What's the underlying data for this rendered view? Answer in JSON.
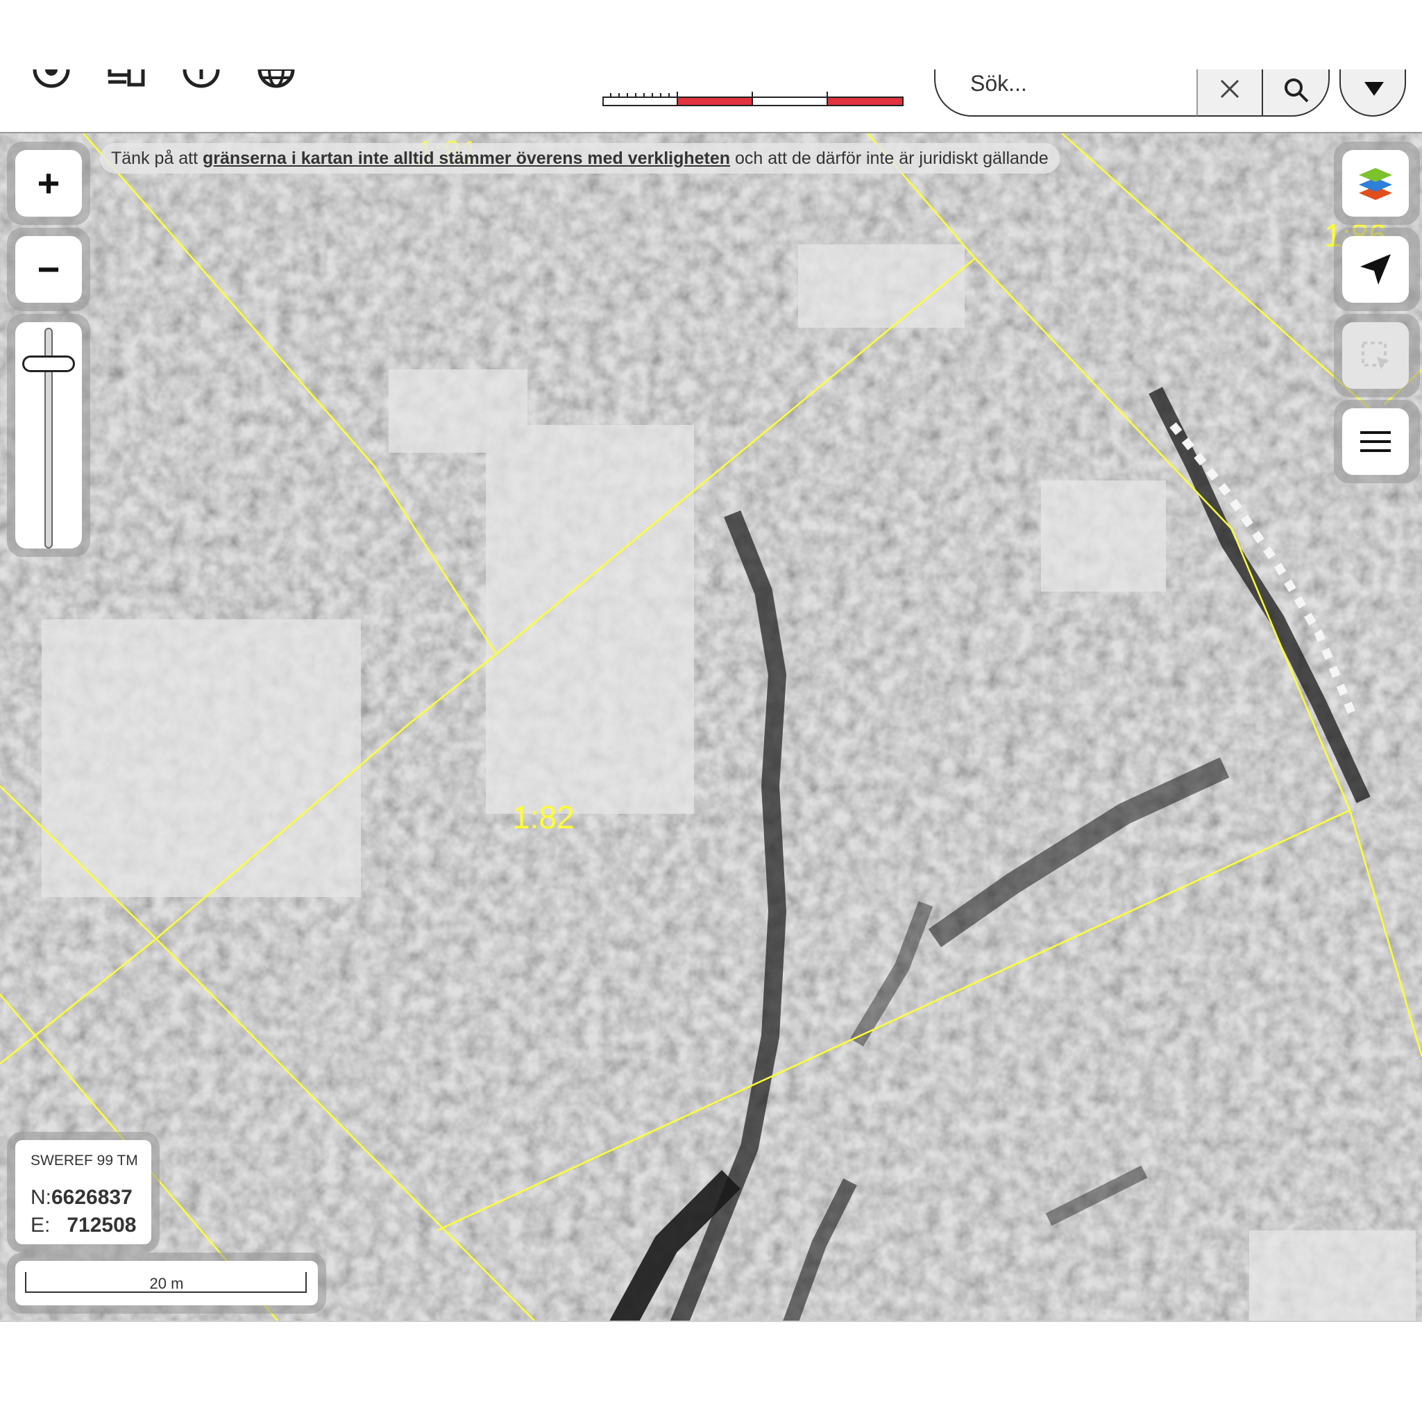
{
  "toolbar": {
    "icons": [
      "target-icon",
      "device-icon",
      "info-icon",
      "globe-icon"
    ],
    "search": {
      "placeholder": "Sök..."
    },
    "bar_scale_colors": [
      "#e23340",
      "#ffffff"
    ]
  },
  "map": {
    "notice": {
      "prefix": "Tänk på att ",
      "link": "gränserna i kartan inte alltid stämmer överens med verkligheten",
      "suffix": " och att de därför inte är juridiskt gällande"
    },
    "parcel_labels": [
      "1:82",
      "1:81",
      "1:86"
    ],
    "boundary_color": "#ffff33",
    "controls": {
      "zoom_in": "+",
      "zoom_out": "−",
      "zoom_level": 0.85,
      "right": [
        "layers-icon",
        "locate-icon",
        "select-area-icon",
        "menu-icon"
      ]
    },
    "coordinates": {
      "projection": "SWEREF 99 TM",
      "n_label": "N:",
      "n_value": "6626837",
      "e_label": "E:",
      "e_value": "712508"
    },
    "scale_bar": {
      "label": "20 m"
    }
  }
}
